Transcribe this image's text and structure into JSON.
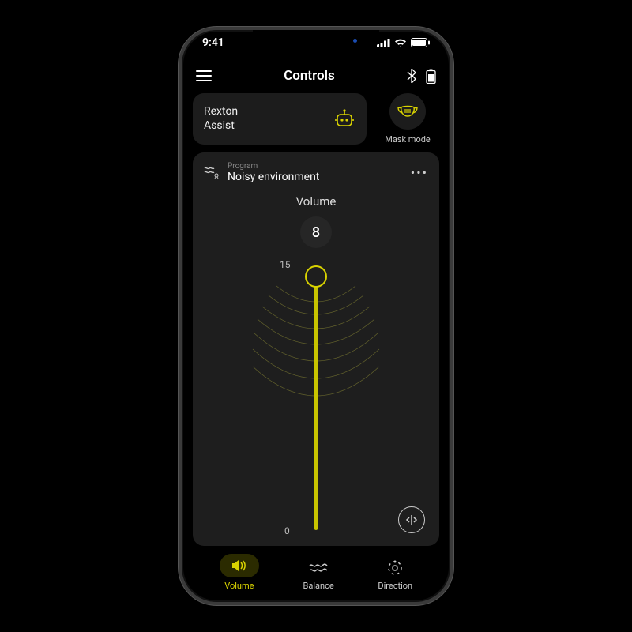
{
  "status": {
    "time": "9:41"
  },
  "header": {
    "title": "Controls"
  },
  "assist": {
    "line1": "Rexton",
    "line2": "Assist"
  },
  "mask": {
    "label": "Mask mode"
  },
  "program": {
    "kicker": "Program",
    "name": "Noisy environment"
  },
  "volume": {
    "title": "Volume",
    "value": "8",
    "max": "15",
    "min": "0"
  },
  "tabs": {
    "volume": "Volume",
    "balance": "Balance",
    "direction": "Direction"
  },
  "colors": {
    "accent": "#d9d300"
  }
}
